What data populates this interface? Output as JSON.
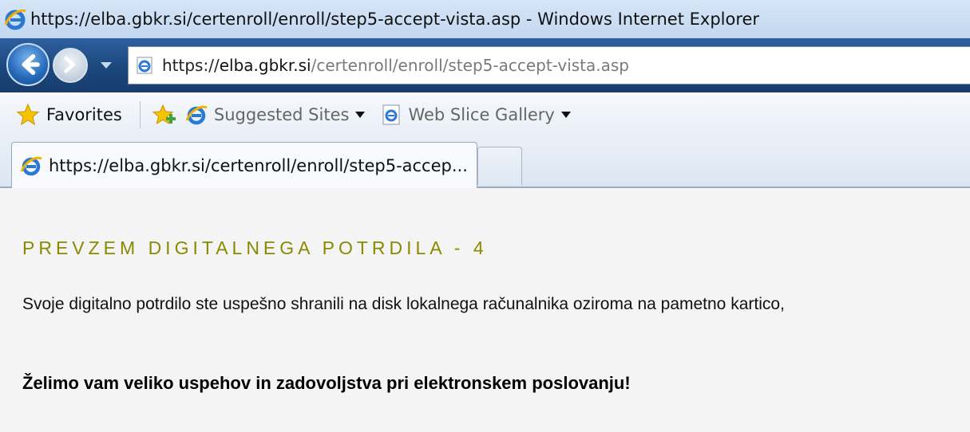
{
  "window": {
    "title": "https://elba.gbkr.si/certenroll/enroll/step5-accept-vista.asp - Windows Internet Explorer"
  },
  "address": {
    "scheme": "https://",
    "domain": "elba.gbkr.si",
    "path": "/certenroll/enroll/step5-accept-vista.asp"
  },
  "favorites": {
    "label": "Favorites",
    "suggested_sites": "Suggested Sites",
    "web_slice_gallery": "Web Slice Gallery"
  },
  "tabs": [
    {
      "label": "https://elba.gbkr.si/certenroll/enroll/step5-accep..."
    }
  ],
  "content": {
    "heading": "PREVZEM DIGITALNEGA POTRDILA - 4",
    "message": "Svoje digitalno potrdilo ste uspešno shranili na disk lokalnega računalnika oziroma na pametno kartico,",
    "wish": "Želimo vam veliko uspehov in zadovoljstva pri elektronskem poslovanju!"
  },
  "colors": {
    "heading": "#8a8a00",
    "navbar": "#1b477d",
    "background": "#f4f4f4"
  },
  "icons": {
    "title": "ie-logo-icon",
    "back": "back-arrow-icon",
    "forward": "forward-arrow-icon",
    "favorites": "favorites-star-icon",
    "add_favorite": "add-favorite-icon",
    "page": "ie-page-icon"
  }
}
